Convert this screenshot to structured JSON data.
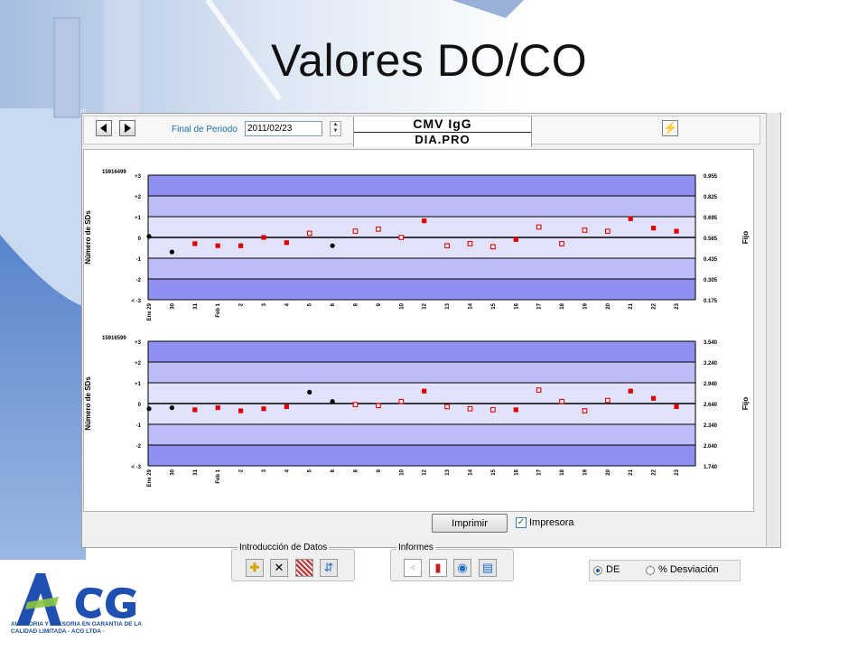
{
  "slide": {
    "title": "Valores DO/CO"
  },
  "toolbar": {
    "period_label": "Final de Periodo",
    "period_value": "2011/02/23"
  },
  "product": {
    "name": "CMV IgG",
    "method": "DIA.PRO"
  },
  "bottom": {
    "print_label": "Imprimir",
    "printer_label": "Impresora",
    "printer_checked": true
  },
  "groups": {
    "data_entry": {
      "title": "Introducción de Datos"
    },
    "reports": {
      "title": "Informes"
    }
  },
  "mode": {
    "options": [
      "DE",
      "% Desviación"
    ],
    "selected": "DE"
  },
  "logo": {
    "brand": "ACG",
    "tagline": "AUDITORIA Y ASESORIA EN GARANTIA DE LA CALIDAD LIMITADA - ACG LTDA -"
  },
  "colors": {
    "band_dark": "#8f8ff0",
    "band_mid": "#bcbcf6",
    "band_light": "#e2e2fc",
    "marker_red": "#e00000",
    "marker_black": "#000000"
  },
  "chart_data": [
    {
      "type": "scatter",
      "lot": "15916499",
      "ylabel": "Número de SDs",
      "y2label": "Fijo",
      "ylim": [
        -3,
        3
      ],
      "y_tick_labels": [
        "+3",
        "+2",
        "+1",
        "0",
        "-1",
        "-2",
        "< -3"
      ],
      "y2_tick_labels": [
        "0.955",
        "0.825",
        "0.695",
        "0.565",
        "0.435",
        "0.305",
        "0.175"
      ],
      "x_tick_labels": [
        "Ene 29",
        "30",
        "31",
        "Feb 1",
        "2",
        "3",
        "4",
        "5",
        "6",
        "8",
        "9",
        "10",
        "12",
        "13",
        "14",
        "15",
        "16",
        "17",
        "18",
        "19",
        "20",
        "21",
        "22",
        "23"
      ],
      "points": [
        {
          "x": 0,
          "y": 0.05,
          "marker": "dot"
        },
        {
          "x": 1,
          "y": -0.7,
          "marker": "dot"
        },
        {
          "x": 2,
          "y": -0.3,
          "marker": "square"
        },
        {
          "x": 3,
          "y": -0.4,
          "marker": "square"
        },
        {
          "x": 4,
          "y": -0.4,
          "marker": "square"
        },
        {
          "x": 5,
          "y": 0.0,
          "marker": "square"
        },
        {
          "x": 6,
          "y": -0.25,
          "marker": "square"
        },
        {
          "x": 7,
          "y": 0.2,
          "marker": "open"
        },
        {
          "x": 8,
          "y": -0.4,
          "marker": "dot"
        },
        {
          "x": 9,
          "y": 0.3,
          "marker": "open"
        },
        {
          "x": 10,
          "y": 0.4,
          "marker": "open"
        },
        {
          "x": 11,
          "y": 0.0,
          "marker": "open"
        },
        {
          "x": 12,
          "y": 0.8,
          "marker": "square"
        },
        {
          "x": 13,
          "y": -0.4,
          "marker": "open"
        },
        {
          "x": 14,
          "y": -0.3,
          "marker": "open"
        },
        {
          "x": 15,
          "y": -0.45,
          "marker": "open"
        },
        {
          "x": 16,
          "y": -0.1,
          "marker": "square"
        },
        {
          "x": 17,
          "y": 0.5,
          "marker": "open"
        },
        {
          "x": 18,
          "y": -0.3,
          "marker": "open"
        },
        {
          "x": 19,
          "y": 0.35,
          "marker": "open"
        },
        {
          "x": 20,
          "y": 0.3,
          "marker": "open"
        },
        {
          "x": 21,
          "y": 0.9,
          "marker": "square"
        },
        {
          "x": 22,
          "y": 0.45,
          "marker": "square"
        },
        {
          "x": 23,
          "y": 0.3,
          "marker": "square"
        }
      ]
    },
    {
      "type": "scatter",
      "lot": "15916599",
      "ylabel": "Número de SDs",
      "y2label": "Fijo",
      "ylim": [
        -3,
        3
      ],
      "y_tick_labels": [
        "+3",
        "+2",
        "+1",
        "0",
        "-1",
        "-2",
        "< -3"
      ],
      "y2_tick_labels": [
        "3.540",
        "3.240",
        "2.940",
        "2.640",
        "2.340",
        "2.040",
        "1.740"
      ],
      "x_tick_labels": [
        "Ene 29",
        "30",
        "31",
        "Feb 1",
        "2",
        "3",
        "4",
        "5",
        "6",
        "8",
        "9",
        "10",
        "12",
        "13",
        "14",
        "15",
        "16",
        "17",
        "18",
        "19",
        "20",
        "21",
        "22",
        "23"
      ],
      "points": [
        {
          "x": 0,
          "y": -0.25,
          "marker": "dot"
        },
        {
          "x": 1,
          "y": -0.2,
          "marker": "dot"
        },
        {
          "x": 2,
          "y": -0.3,
          "marker": "square"
        },
        {
          "x": 3,
          "y": -0.2,
          "marker": "square"
        },
        {
          "x": 4,
          "y": -0.35,
          "marker": "square"
        },
        {
          "x": 5,
          "y": -0.25,
          "marker": "square"
        },
        {
          "x": 6,
          "y": -0.15,
          "marker": "square"
        },
        {
          "x": 7,
          "y": 0.55,
          "marker": "dot"
        },
        {
          "x": 8,
          "y": 0.1,
          "marker": "dot"
        },
        {
          "x": 9,
          "y": -0.05,
          "marker": "open"
        },
        {
          "x": 10,
          "y": -0.1,
          "marker": "open"
        },
        {
          "x": 11,
          "y": 0.1,
          "marker": "open"
        },
        {
          "x": 12,
          "y": 0.6,
          "marker": "square"
        },
        {
          "x": 13,
          "y": -0.15,
          "marker": "open"
        },
        {
          "x": 14,
          "y": -0.25,
          "marker": "open"
        },
        {
          "x": 15,
          "y": -0.3,
          "marker": "open"
        },
        {
          "x": 16,
          "y": -0.3,
          "marker": "square"
        },
        {
          "x": 17,
          "y": 0.65,
          "marker": "open"
        },
        {
          "x": 18,
          "y": 0.1,
          "marker": "open"
        },
        {
          "x": 19,
          "y": -0.35,
          "marker": "open"
        },
        {
          "x": 20,
          "y": 0.15,
          "marker": "open"
        },
        {
          "x": 21,
          "y": 0.6,
          "marker": "square"
        },
        {
          "x": 22,
          "y": 0.25,
          "marker": "square"
        },
        {
          "x": 23,
          "y": -0.15,
          "marker": "square"
        }
      ]
    }
  ]
}
